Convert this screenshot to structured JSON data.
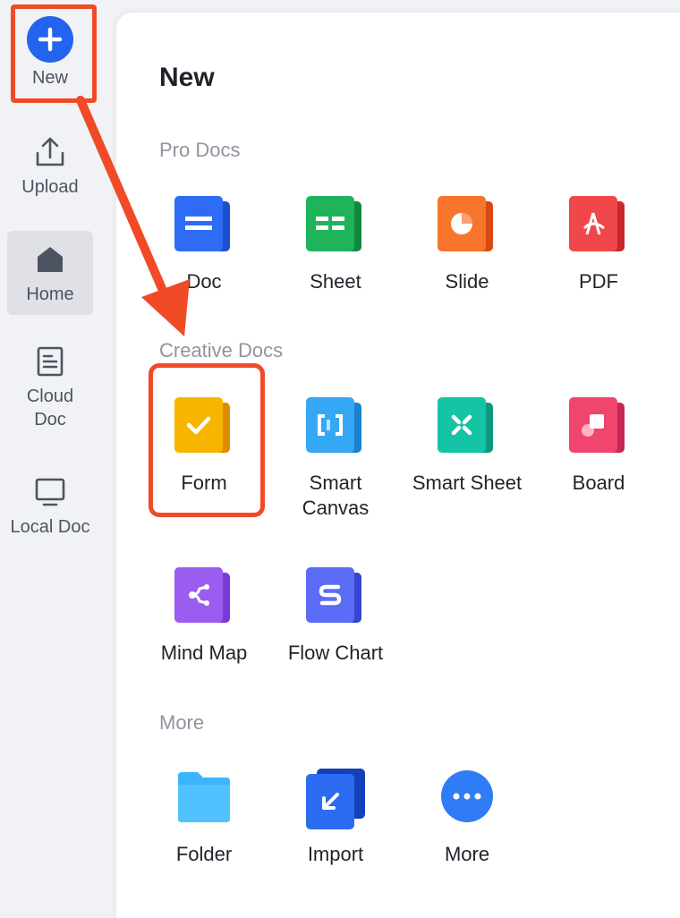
{
  "sidebar": {
    "new_label": "New",
    "upload_label": "Upload",
    "home_label": "Home",
    "cloud_label_1": "Cloud",
    "cloud_label_2": "Doc",
    "local_label": "Local Doc"
  },
  "panel": {
    "title": "New",
    "sections": {
      "pro": "Pro Docs",
      "creative": "Creative Docs",
      "more": "More"
    },
    "pro_items": {
      "doc": "Doc",
      "sheet": "Sheet",
      "slide": "Slide",
      "pdf": "PDF"
    },
    "creative_items": {
      "form": "Form",
      "smart_canvas_1": "Smart",
      "smart_canvas_2": "Canvas",
      "smart_sheet": "Smart Sheet",
      "board": "Board",
      "mind_map": "Mind Map",
      "flow_chart": "Flow Chart"
    },
    "more_items": {
      "folder": "Folder",
      "import": "Import",
      "more": "More"
    }
  },
  "colors": {
    "accent": "#2463f0",
    "annotation": "#f04a26",
    "doc": "#2f6cf6",
    "sheet": "#1fb35a",
    "slide": "#f7752c",
    "pdf": "#f0474a",
    "form": "#f7b500",
    "smart_canvas": "#35a8f5",
    "smart_sheet": "#14c4a4",
    "board": "#f0456c",
    "mind_map": "#9b5cf0",
    "flow_chart": "#5b6cf7",
    "folder": "#3cb4ff",
    "import": "#2b6cf0",
    "more": "#2f7cf6"
  }
}
